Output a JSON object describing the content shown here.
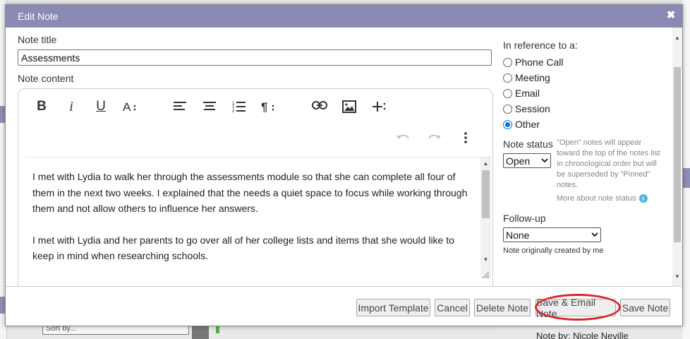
{
  "modal": {
    "title": "Edit Note",
    "close_glyph": "✖"
  },
  "note": {
    "title_label": "Note title",
    "title_value": "Assessments",
    "content_label": "Note content",
    "paragraphs": [
      "I met with Lydia to walk her through the assessments module so that she can complete all four of them in the next two weeks. I explained that the needs a quiet space to focus while working through them and not allow others to influence her answers.",
      "I met with Lydia and her parents to go over all of her college lists and items that she would like to keep in mind when researching schools."
    ]
  },
  "toolbar": {
    "icons": [
      "bold-icon",
      "italic-icon",
      "underline-icon",
      "font-size-icon",
      "align-left-icon",
      "align-center-icon",
      "ordered-list-icon",
      "paragraph-format-icon",
      "link-icon",
      "image-icon",
      "insert-more-icon",
      "undo-icon",
      "redo-icon",
      "more-options-icon"
    ],
    "bold_glyph": "B",
    "italic_glyph": "i",
    "underline_glyph": "U"
  },
  "reference": {
    "label": "In reference to a:",
    "options": [
      "Phone Call",
      "Meeting",
      "Email",
      "Session",
      "Other"
    ],
    "selected": "Other"
  },
  "status": {
    "label": "Note status",
    "value": "Open",
    "help": "\"Open\" notes will appear toward the top of the notes list in chronological order but will be superseded by \"Pinned\" notes.",
    "more_link": "More about note status"
  },
  "followup": {
    "label": "Follow-up",
    "value": "None",
    "created_by": "Note originally created by me"
  },
  "footer": {
    "import_template": "Import Template",
    "cancel": "Cancel",
    "delete_note": "Delete Note",
    "save_email_note": "Save & Email Note",
    "save_note": "Save Note"
  },
  "background": {
    "sort_placeholder": "Sort by...",
    "note_by": "Note by: Nicole Neville"
  },
  "colors": {
    "header": "#8a8ab5",
    "highlight_ring": "#d9252b",
    "radio_checked": "#0075d9",
    "info_icon": "#52b5d8"
  }
}
